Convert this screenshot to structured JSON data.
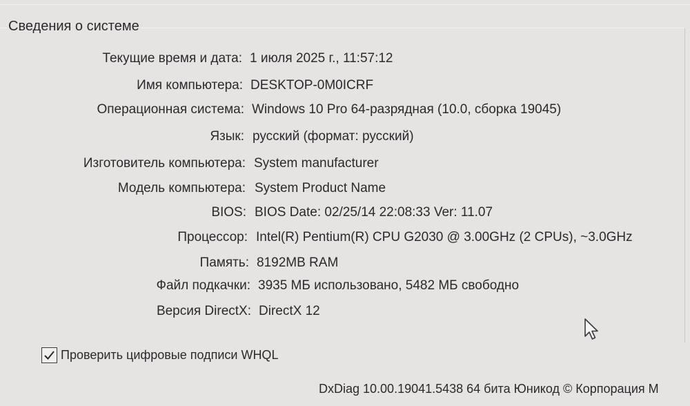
{
  "section_title": "Сведения о системе",
  "rows": [
    {
      "label": "Текущие время и дата:",
      "value": "1 июля 2025 г., 11:57:12"
    },
    {
      "label": "Имя компьютера:",
      "value": "DESKTOP-0M0ICRF"
    },
    {
      "label": "Операционная система:",
      "value": "Windows 10 Pro 64-разрядная (10.0, сборка 19045)"
    },
    {
      "label": "Язык:",
      "value": "русский (формат: русский)"
    },
    {
      "label": "Изготовитель компьютера:",
      "value": "System manufacturer"
    },
    {
      "label": "Модель компьютера:",
      "value": "System Product Name"
    },
    {
      "label": "BIOS:",
      "value": "BIOS Date: 02/25/14 22:08:33 Ver: 11.07"
    },
    {
      "label": "Процессор:",
      "value": "Intel(R) Pentium(R) CPU G2030 @ 3.00GHz (2 CPUs), ~3.0GHz"
    },
    {
      "label": "Память:",
      "value": "8192MB RAM"
    },
    {
      "label": "Файл подкачки:",
      "value": "3935 МБ использовано, 5482 МБ свободно"
    },
    {
      "label": "Версия DirectX:",
      "value": "DirectX 12"
    }
  ],
  "whql_checkbox": {
    "label": "Проверить цифровые подписи WHQL",
    "checked": true
  },
  "footer": "DxDiag 10.00.19041.5438 64 бита Юникод © Корпорация М",
  "icons": {
    "checkmark": "checkmark-icon",
    "cursor": "mouse-pointer-icon"
  }
}
